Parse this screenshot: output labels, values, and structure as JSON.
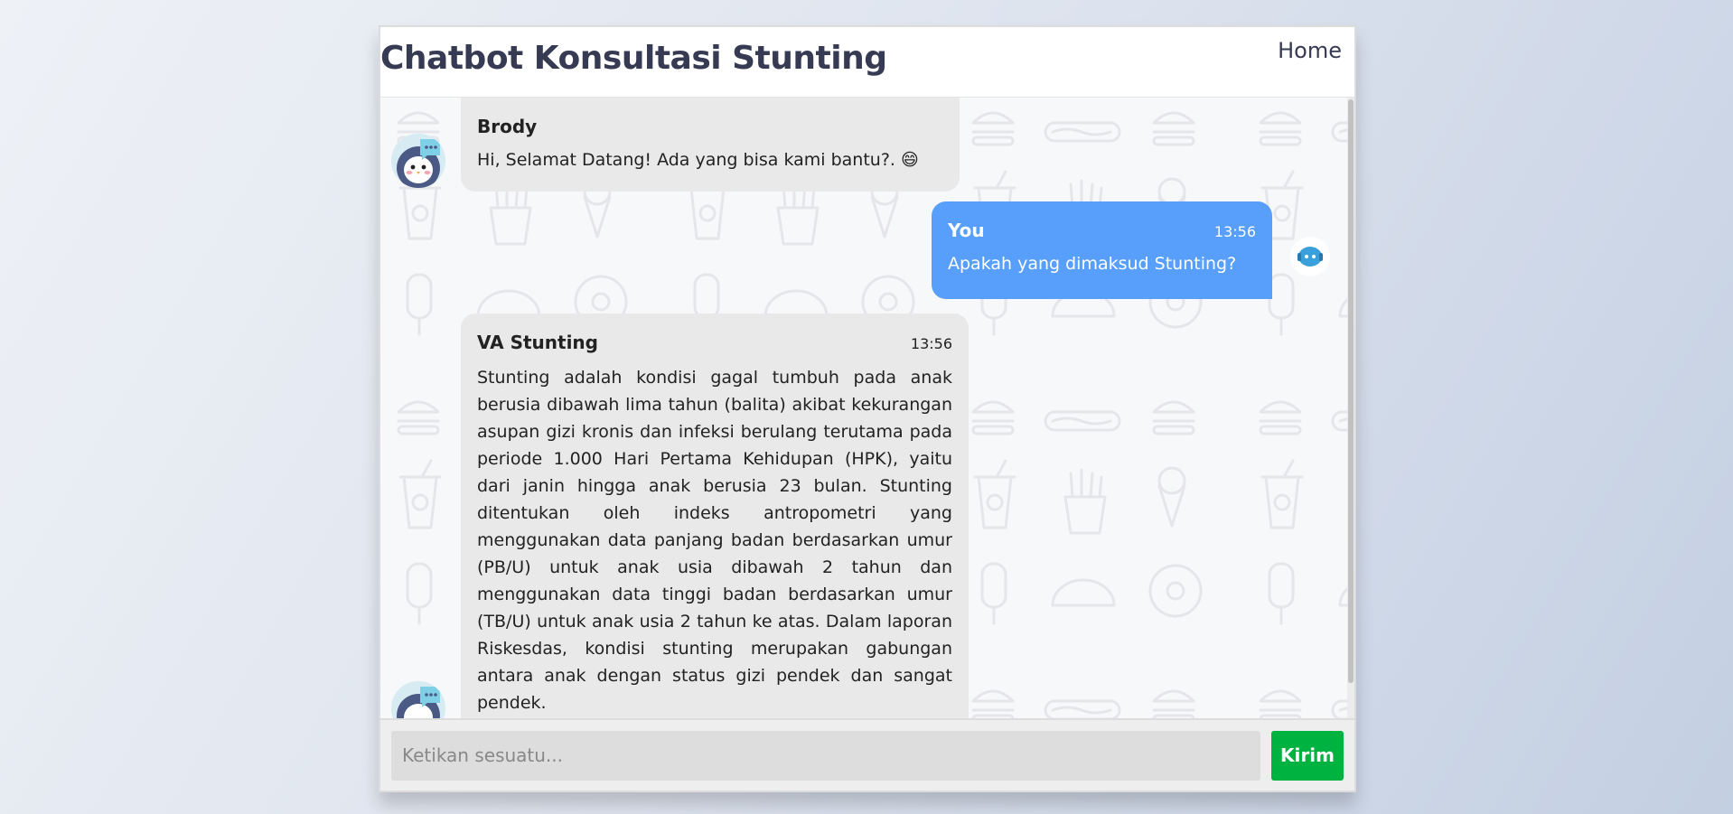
{
  "header": {
    "title": "Chatbot Konsultasi Stunting",
    "nav_home": "Home"
  },
  "messages": [
    {
      "sender": "Brody",
      "time": "",
      "text": "Hi, Selamat Datang! Ada yang bisa kami bantu?. 😄",
      "side": "left"
    },
    {
      "sender": "You",
      "time": "13:56",
      "text": "Apakah yang dimaksud Stunting?",
      "side": "right"
    },
    {
      "sender": "VA Stunting",
      "time": "13:56",
      "text": "Stunting adalah kondisi gagal tumbuh pada anak berusia dibawah lima tahun (balita) akibat kekurangan asupan gizi kronis dan infeksi berulang terutama pada periode 1.000 Hari Pertama Kehidupan (HPK), yaitu dari janin hingga anak berusia 23 bulan. Stunting ditentukan oleh indeks antropometri yang menggunakan data panjang badan berdasarkan umur (PB/U) untuk anak usia dibawah 2 tahun dan menggunakan data tinggi badan berdasarkan umur (TB/U) untuk anak usia 2 tahun ke atas. Dalam laporan Riskesdas, kondisi stunting merupakan gabungan antara anak dengan status gizi pendek dan sangat pendek.",
      "side": "left"
    }
  ],
  "input": {
    "placeholder": "Ketikan sesuatu...",
    "value": ""
  },
  "send_button": "Kirim",
  "colors": {
    "bot_bubble": "#e9e9e9",
    "user_bubble": "#579ffb",
    "send_button": "#00b341",
    "title": "#363a52"
  }
}
